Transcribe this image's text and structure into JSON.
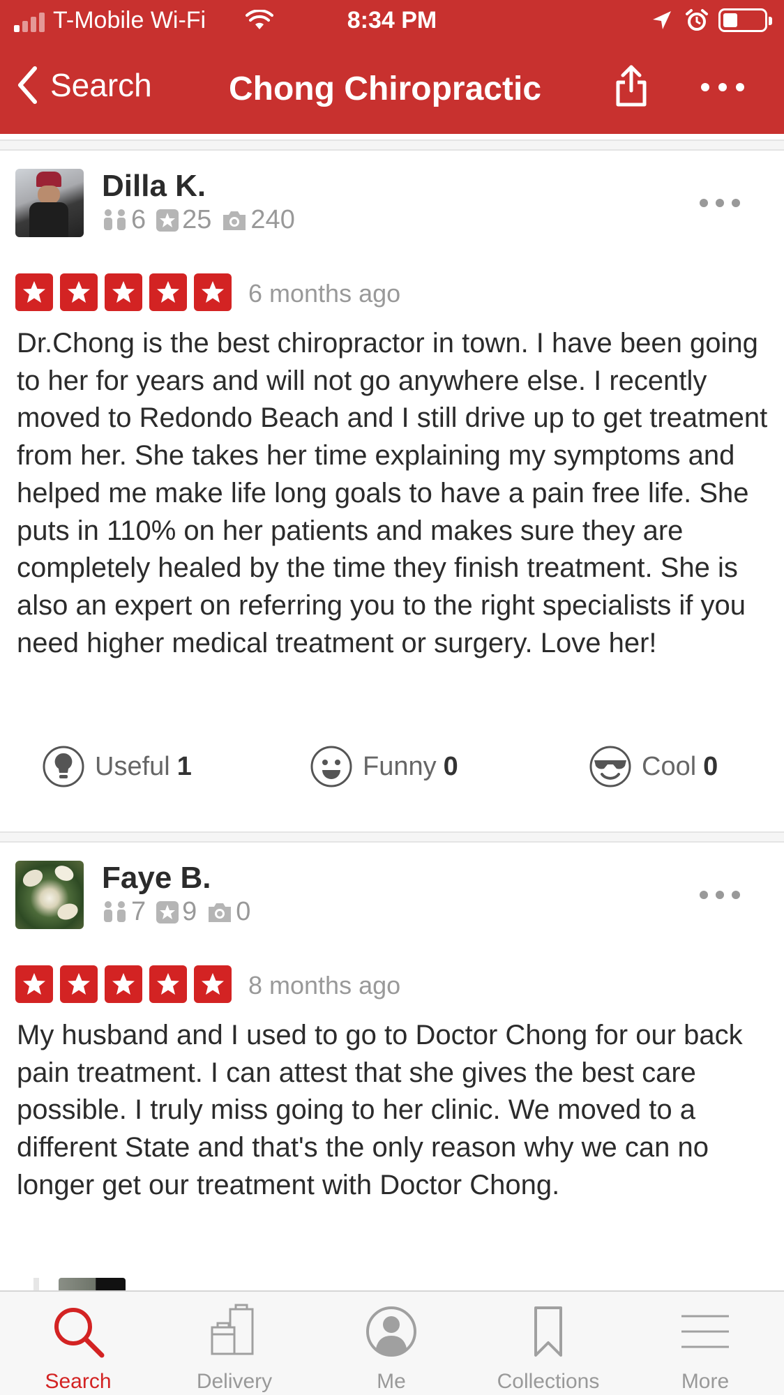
{
  "status_bar": {
    "carrier": "T-Mobile Wi-Fi",
    "time": "8:34 PM",
    "battery_level": 0.35
  },
  "nav": {
    "back_label": "Search",
    "title": "Chong Chiropractic"
  },
  "reviews": [
    {
      "name": "Dilla K.",
      "friends": "6",
      "reviews_count": "25",
      "photos": "240",
      "rating": 5,
      "time": "6 months ago",
      "text": "Dr.Chong is the best chiropractor in town. I have been going to her for years and will not go anywhere else. I recently moved to Redondo Beach and I still drive up to get treatment from her. She takes her time explaining my symptoms and helped me make life long goals to have a pain free life. She puts in 110% on her patients and makes sure they are completely healed by the time they finish treatment. She is also an expert on referring you to the right specialists if you need higher medical treatment or surgery. Love her!",
      "votes": {
        "useful_label": "Useful",
        "useful": "1",
        "funny_label": "Funny",
        "funny": "0",
        "cool_label": "Cool",
        "cool": "0"
      }
    },
    {
      "name": "Faye B.",
      "friends": "7",
      "reviews_count": "9",
      "photos": "0",
      "rating": 5,
      "time": "8 months ago",
      "text": "My husband and I used to go to Doctor Chong for our back pain treatment. I can attest that she gives the best care possible. I truly miss going to her clinic. We moved to a different State and that's the only reason why we can no longer get our treatment with Doctor Chong."
    }
  ],
  "tabs": [
    {
      "label": "Search",
      "icon": "search-icon",
      "active": true
    },
    {
      "label": "Delivery",
      "icon": "delivery-bag-icon",
      "active": false
    },
    {
      "label": "Me",
      "icon": "profile-icon",
      "active": false
    },
    {
      "label": "Collections",
      "icon": "bookmark-icon",
      "active": false
    },
    {
      "label": "More",
      "icon": "hamburger-icon",
      "active": false
    }
  ],
  "colors": {
    "brand_red": "#c8312f",
    "star_red": "#d32323",
    "muted_text": "#999999"
  }
}
